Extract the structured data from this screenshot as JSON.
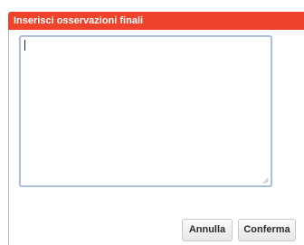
{
  "dialog": {
    "title": "Inserisci osservazioni finali",
    "notes_value": "",
    "colors": {
      "title_bar": "#f0432c",
      "title_text": "#ffffff"
    },
    "buttons": {
      "cancel_label": "Annulla",
      "confirm_label": "Conferma"
    }
  }
}
